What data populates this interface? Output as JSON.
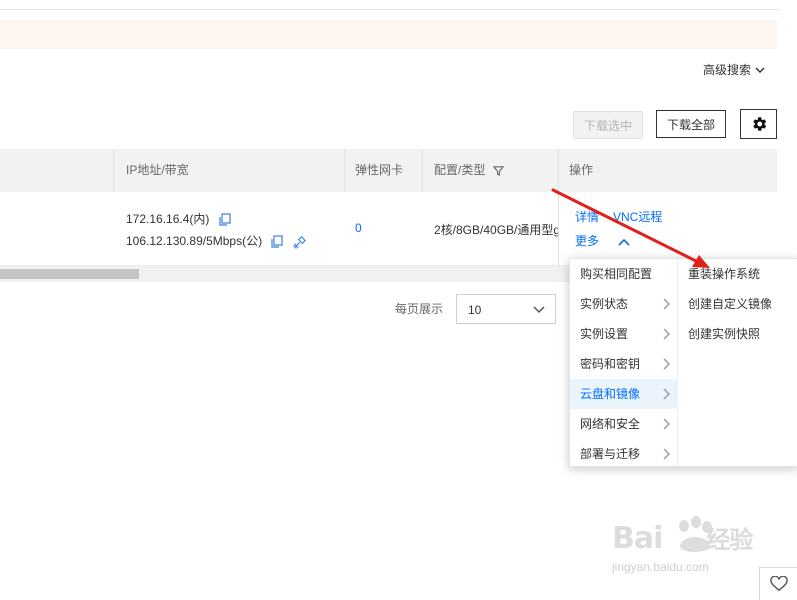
{
  "toolbar": {
    "advanced_search": "高级搜索",
    "download_selected": "下载选中",
    "download_all": "下载全部"
  },
  "table": {
    "headers": {
      "ip_bandwidth": "IP地址/带宽",
      "elastic_nic": "弹性网卡",
      "config_type": "配置/类型",
      "operations": "操作"
    },
    "rows": [
      {
        "private_ip": "172.16.16.4(内)",
        "public_ip": "106.12.130.89/5Mbps(公)",
        "elastic_nic": "0",
        "config_type": "2核/8GB/40GB/通用型g",
        "op_details": "详情",
        "op_vnc": "VNC远程",
        "op_more": "更多"
      }
    ]
  },
  "pagination": {
    "per_page_label": "每页展示",
    "per_page_value": "10"
  },
  "more_menu": {
    "items": [
      {
        "label": "购买相同配置",
        "has_submenu": false
      },
      {
        "label": "实例状态",
        "has_submenu": true
      },
      {
        "label": "实例设置",
        "has_submenu": true
      },
      {
        "label": "密码和密钥",
        "has_submenu": true
      },
      {
        "label": "云盘和镜像",
        "has_submenu": true,
        "active": true
      },
      {
        "label": "网络和安全",
        "has_submenu": true
      },
      {
        "label": "部署与迁移",
        "has_submenu": true
      }
    ],
    "submenu": [
      {
        "label": "重装操作系统"
      },
      {
        "label": "创建自定义镜像"
      },
      {
        "label": "创建实例快照"
      }
    ]
  },
  "watermark": {
    "brand": "Bai",
    "brand_cn": "经验",
    "site": "jingyan.baidu.com"
  },
  "colors": {
    "link": "#006eff",
    "arrow": "#e0211b",
    "notice_bg": "#fdf6ef",
    "header_bg": "#f2f2f2",
    "menu_active_bg": "#ebf3fd"
  }
}
